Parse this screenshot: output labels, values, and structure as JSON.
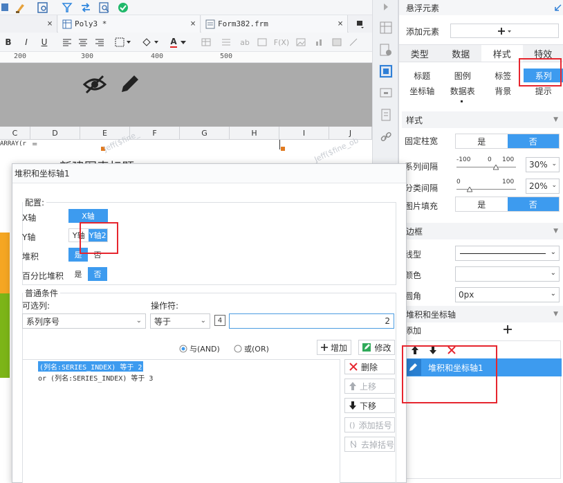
{
  "tabs": [
    {
      "label": "Poly3 *"
    },
    {
      "label": "Form382.frm"
    }
  ],
  "format_bar": {
    "bold": "B",
    "italic": "I",
    "underline": "U",
    "text_color_letter": "A",
    "icon_ab": "ab",
    "icon_fx": "F(X)"
  },
  "ruler": {
    "marks": [
      "200",
      "300",
      "400",
      "500"
    ]
  },
  "columns": [
    "C",
    "D",
    "E",
    "F",
    "G",
    "H",
    "I",
    "J"
  ],
  "sheet": {
    "cell_text": "ARRAY(r",
    "equals_text": "=",
    "watermark": "Jeff($fine_",
    "watermark2": "Jeff($fine_ob",
    "chart_title_partial": "新建图表标题"
  },
  "panel": {
    "title": "悬浮元素",
    "add_element_label": "添加元素",
    "main_tabs": [
      "类型",
      "数据",
      "样式",
      "特效"
    ],
    "sub_tabs_row1": [
      "标题",
      "图例",
      "标签",
      "系列"
    ],
    "sub_tabs_row2": [
      "坐标轴",
      "数据表",
      "背景",
      "提示"
    ],
    "style_section": "样式",
    "fixed_width_label": "固定柱宽",
    "fixed_width_options": [
      "是",
      "否"
    ],
    "series_gap_label": "系列间隔",
    "series_gap_ticks": [
      "-100",
      "0",
      "100"
    ],
    "series_gap_value": "30%",
    "category_gap_label": "分类间隔",
    "category_gap_ticks": [
      "0",
      "100"
    ],
    "category_gap_value": "20%",
    "image_fill_label": "图片填充",
    "image_fill_options": [
      "是",
      "否"
    ],
    "border_section": "边框",
    "line_type_label": "线型",
    "color_label": "颜色",
    "radius_label": "圆角",
    "radius_value": "0px",
    "stack_axis_section": "堆积和坐标轴",
    "add_label": "添加",
    "list_item": "堆积和坐标轴1"
  },
  "dialog": {
    "title": "堆积和坐标轴1",
    "config_legend": "配置:",
    "x_axis_label": "X轴",
    "x_axis_value": "X轴",
    "y_axis_label": "Y轴",
    "y_axis_options": [
      "Y轴",
      "Y轴2"
    ],
    "stack_label": "堆积",
    "stack_options": [
      "是",
      "否"
    ],
    "percent_stack_label": "百分比堆积",
    "percent_stack_options": [
      "是",
      "否"
    ],
    "cond_legend": "普通条件",
    "optional_col_label": "可选列:",
    "optional_col_value": "系列序号",
    "operator_label": "操作符:",
    "operator_value": "等于",
    "value_type_badge": "4",
    "value_input": "2",
    "and_label": "与(AND)",
    "or_label": "或(OR)",
    "add_button": "增加",
    "modify_button": "修改",
    "conditions": [
      "(列名:SERIES_INDEX) 等于 2",
      "or  (列名:SERIES_INDEX) 等于 3"
    ],
    "delete_button": "删除",
    "move_up_button": "上移",
    "move_down_button": "下移",
    "add_bracket_button": "添加括号",
    "remove_bracket_button": "去掉括号"
  },
  "colors": {
    "accent": "#3d9bef",
    "highlight_red": "#e6252e",
    "orange_cell": "#f5a623",
    "green_cell": "#7cb518"
  }
}
